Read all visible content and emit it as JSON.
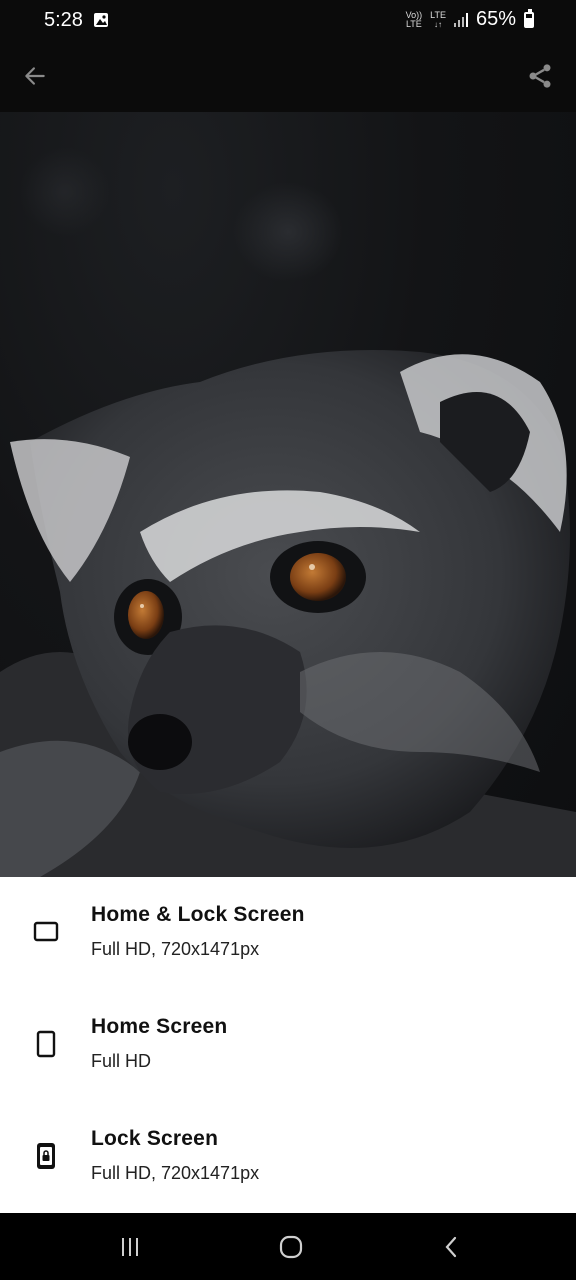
{
  "status_bar": {
    "time": "5:28",
    "network_volte": "Vo))\nLTE",
    "network_lte": "LTE",
    "battery": "65%",
    "battery_level": 0.65,
    "icons": [
      "gallery-notification-icon",
      "signal-icon",
      "battery-icon"
    ]
  },
  "app_bar": {
    "back_icon": "arrow-back-icon",
    "share_icon": "share-icon"
  },
  "preview": {
    "subject": "lemur-wallpaper-image"
  },
  "options": [
    {
      "title": "Home & Lock Screen",
      "subtitle": "Full HD, 720x1471px",
      "icon": "tablet-landscape-icon"
    },
    {
      "title": "Home Screen",
      "subtitle": "Full HD",
      "icon": "phone-outline-icon"
    },
    {
      "title": "Lock Screen",
      "subtitle": "Full HD, 720x1471px",
      "icon": "phone-lock-icon"
    }
  ],
  "nav_bar": {
    "recents_icon": "recents-icon",
    "home_icon": "home-icon",
    "back_icon": "nav-back-icon"
  },
  "colors": {
    "sheet_bg": "#ffffff",
    "title_text": "#111111",
    "dark_bg": "#0b0b0b"
  }
}
